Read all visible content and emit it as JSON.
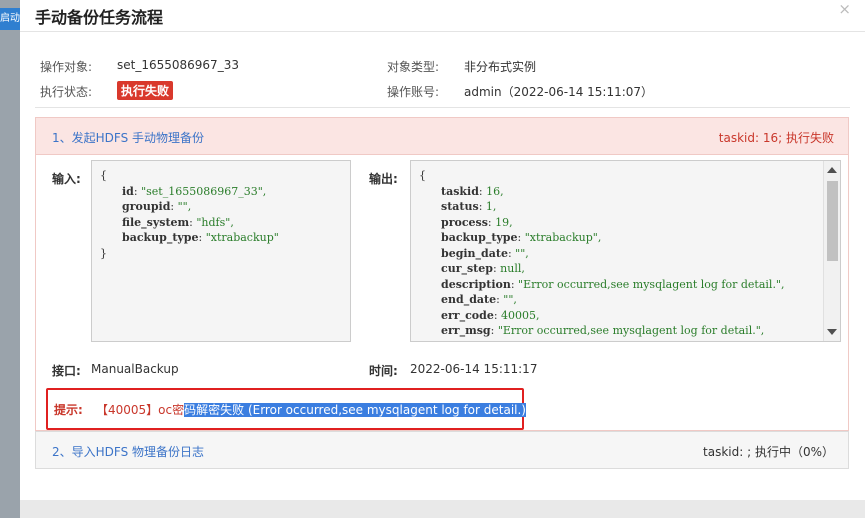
{
  "background": {
    "tab_label": "启动"
  },
  "dialog": {
    "title": "手动备份任务流程",
    "close": "×"
  },
  "info": {
    "object_label": "操作对象:",
    "object_value": "set_1655086967_33",
    "type_label": "对象类型:",
    "type_value": "非分布式实例",
    "status_label": "执行状态:",
    "status_value": "执行失败",
    "account_label": "操作账号:",
    "account_value": "admin（2022-06-14 15:11:07）"
  },
  "step1": {
    "title": "1、发起HDFS 手动物理备份",
    "status": "taskid: 16; 执行失败",
    "input_label": "输入:",
    "output_label": "输出:",
    "input_lines": [
      {
        "key": "{",
        "val": ""
      },
      {
        "key": "id",
        "val": "\"set_1655086967_33\","
      },
      {
        "key": "groupid",
        "val": "\"\","
      },
      {
        "key": "file_system",
        "val": "\"hdfs\","
      },
      {
        "key": "backup_type",
        "val": "\"xtrabackup\""
      },
      {
        "key": "}",
        "val": ""
      }
    ],
    "output_lines": [
      {
        "key": "{",
        "val": ""
      },
      {
        "key": "taskid",
        "val": "16,"
      },
      {
        "key": "status",
        "val": "1,"
      },
      {
        "key": "process",
        "val": "19,"
      },
      {
        "key": "backup_type",
        "val": "\"xtrabackup\","
      },
      {
        "key": "begin_date",
        "val": "\"\","
      },
      {
        "key": "cur_step",
        "val": "null,"
      },
      {
        "key": "description",
        "val": "\"Error occurred,see mysqlagent log for detail.\","
      },
      {
        "key": "end_date",
        "val": "\"\","
      },
      {
        "key": "err_code",
        "val": "40005,"
      },
      {
        "key": "err_msg",
        "val": "\"Error occurred,see mysqlagent log for detail.\","
      }
    ],
    "interface_label": "接口:",
    "interface_value": "ManualBackup",
    "time_label": "时间:",
    "time_value": "2022-06-14 15:11:17",
    "hint_label": "提示:",
    "hint_prefix": "【40005】oc密",
    "hint_selected": "码解密失败 (Error occurred,see mysqlagent log for detail.)"
  },
  "step2": {
    "title": "2、导入HDFS 物理备份日志",
    "status": "taskid: ; 执行中（0%）"
  }
}
